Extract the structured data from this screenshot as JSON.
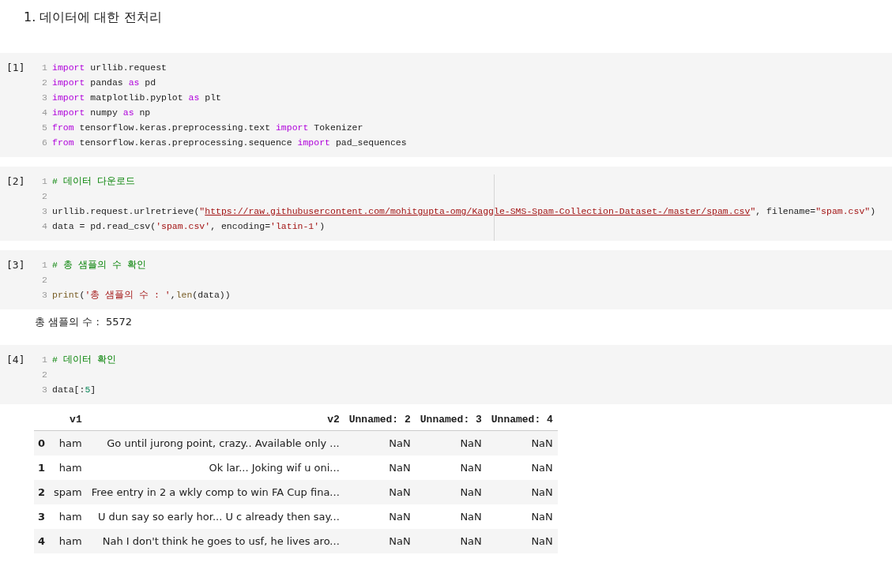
{
  "heading": "1. 데이터에 대한 전처리",
  "cells": [
    {
      "prompt": "[1]",
      "lines": [
        {
          "number": "1",
          "tokens": [
            {
              "kind": "keyword",
              "text": "import"
            },
            {
              "kind": "plain",
              "text": " urllib.request"
            }
          ]
        },
        {
          "number": "2",
          "tokens": [
            {
              "kind": "keyword",
              "text": "import"
            },
            {
              "kind": "plain",
              "text": " pandas "
            },
            {
              "kind": "keyword",
              "text": "as"
            },
            {
              "kind": "plain",
              "text": " pd"
            }
          ]
        },
        {
          "number": "3",
          "tokens": [
            {
              "kind": "keyword",
              "text": "import"
            },
            {
              "kind": "plain",
              "text": " matplotlib.pyplot "
            },
            {
              "kind": "keyword",
              "text": "as"
            },
            {
              "kind": "plain",
              "text": " plt"
            }
          ]
        },
        {
          "number": "4",
          "tokens": [
            {
              "kind": "keyword",
              "text": "import"
            },
            {
              "kind": "plain",
              "text": " numpy "
            },
            {
              "kind": "keyword",
              "text": "as"
            },
            {
              "kind": "plain",
              "text": " np"
            }
          ]
        },
        {
          "number": "5",
          "tokens": [
            {
              "kind": "keyword",
              "text": "from"
            },
            {
              "kind": "plain",
              "text": " tensorflow.keras.preprocessing.text "
            },
            {
              "kind": "keyword",
              "text": "import"
            },
            {
              "kind": "plain",
              "text": " Tokenizer"
            }
          ]
        },
        {
          "number": "6",
          "tokens": [
            {
              "kind": "keyword",
              "text": "from"
            },
            {
              "kind": "plain",
              "text": " tensorflow.keras.preprocessing.sequence "
            },
            {
              "kind": "keyword",
              "text": "import"
            },
            {
              "kind": "plain",
              "text": " pad_sequences"
            }
          ]
        }
      ]
    },
    {
      "prompt": "[2]",
      "ruler": true,
      "lines": [
        {
          "number": "1",
          "tokens": [
            {
              "kind": "comment",
              "text": "# 데이터 다운로드"
            }
          ]
        },
        {
          "number": "2"
        },
        {
          "number": "3",
          "tokens": [
            {
              "kind": "plain",
              "text": "urllib.request.urlretrieve("
            },
            {
              "kind": "string",
              "text": "\""
            },
            {
              "kind": "link",
              "text": "https://raw.githubusercontent.com/mohitgupta-omg/Kaggle-SMS-Spam-Collection-Dataset-/master/spam.csv"
            },
            {
              "kind": "string",
              "text": "\""
            },
            {
              "kind": "plain",
              "text": ", filename="
            },
            {
              "kind": "string",
              "text": "\"spam.csv\""
            },
            {
              "kind": "plain",
              "text": ")"
            }
          ]
        },
        {
          "number": "4",
          "tokens": [
            {
              "kind": "plain",
              "text": "data = pd.read_csv("
            },
            {
              "kind": "string",
              "text": "'spam.csv'"
            },
            {
              "kind": "plain",
              "text": ", encoding="
            },
            {
              "kind": "string",
              "text": "'latin-1'"
            },
            {
              "kind": "plain",
              "text": ")"
            }
          ]
        }
      ]
    },
    {
      "prompt": "[3]",
      "lines": [
        {
          "number": "1",
          "tokens": [
            {
              "kind": "comment",
              "text": "# 총 샘플의 수 확인"
            }
          ]
        },
        {
          "number": "2"
        },
        {
          "number": "3",
          "tokens": [
            {
              "kind": "builtin",
              "text": "print"
            },
            {
              "kind": "plain",
              "text": "("
            },
            {
              "kind": "string",
              "text": "'총 샘플의 수 : '"
            },
            {
              "kind": "plain",
              "text": ","
            },
            {
              "kind": "builtin",
              "text": "len"
            },
            {
              "kind": "plain",
              "text": "(data))"
            }
          ]
        }
      ],
      "output": "총 샘플의 수 :  5572"
    },
    {
      "prompt": "[4]",
      "lines": [
        {
          "number": "1",
          "tokens": [
            {
              "kind": "comment",
              "text": "# 데이터 확인"
            }
          ]
        },
        {
          "number": "2"
        },
        {
          "number": "3",
          "tokens": [
            {
              "kind": "plain",
              "text": "data[:"
            },
            {
              "kind": "number",
              "text": "5"
            },
            {
              "kind": "plain",
              "text": "]"
            }
          ]
        }
      ],
      "table": {
        "columns": [
          "v1",
          "v2",
          "Unnamed: 2",
          "Unnamed: 3",
          "Unnamed: 4"
        ],
        "rows": [
          {
            "index": "0",
            "cells": [
              "ham",
              "Go until jurong point, crazy.. Available only ...",
              "NaN",
              "NaN",
              "NaN"
            ]
          },
          {
            "index": "1",
            "cells": [
              "ham",
              "Ok lar... Joking wif u oni...",
              "NaN",
              "NaN",
              "NaN"
            ]
          },
          {
            "index": "2",
            "cells": [
              "spam",
              "Free entry in 2 a wkly comp to win FA Cup fina...",
              "NaN",
              "NaN",
              "NaN"
            ]
          },
          {
            "index": "3",
            "cells": [
              "ham",
              "U dun say so early hor... U c already then say...",
              "NaN",
              "NaN",
              "NaN"
            ]
          },
          {
            "index": "4",
            "cells": [
              "ham",
              "Nah I don't think he goes to usf, he lives aro...",
              "NaN",
              "NaN",
              "NaN"
            ]
          }
        ]
      }
    }
  ]
}
